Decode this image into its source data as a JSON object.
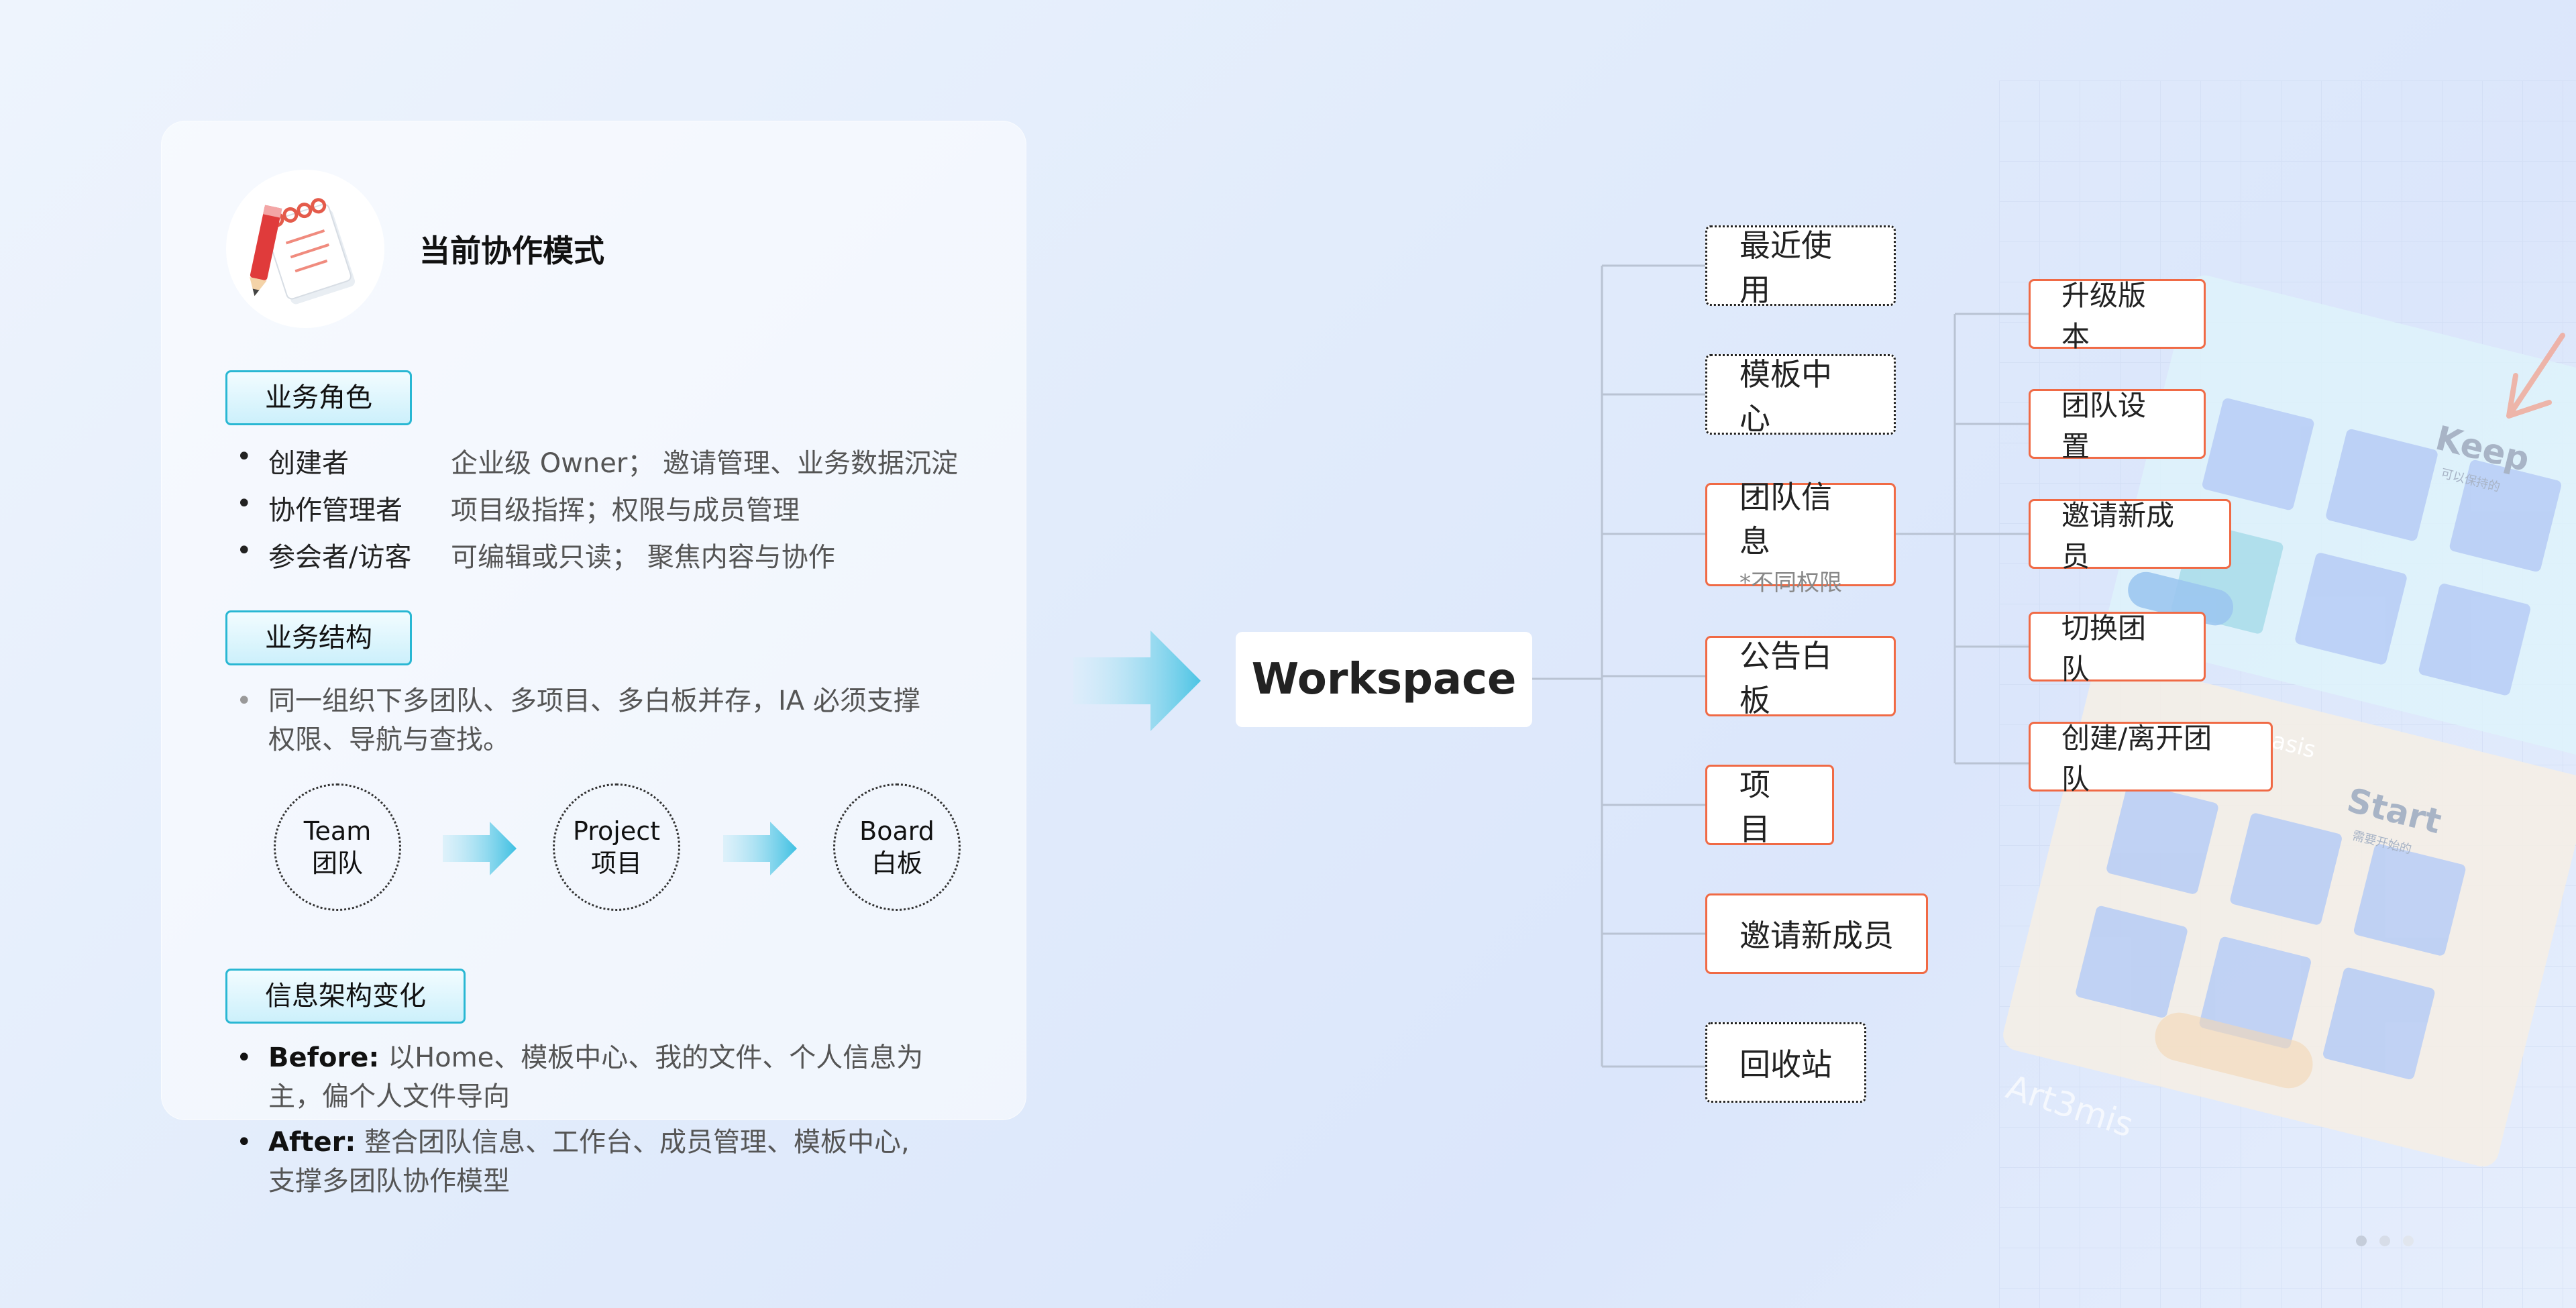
{
  "card": {
    "title": "当前协作模式",
    "roles_tag": "业务角色",
    "roles": [
      {
        "name": "创建者",
        "desc": "企业级 Owner； 邀请管理、业务数据沉淀"
      },
      {
        "name": "协作管理者",
        "desc": "项目级指挥；权限与成员管理"
      },
      {
        "name": "参会者/访客",
        "desc": "可编辑或只读； 聚焦内容与协作"
      }
    ],
    "structure_tag": "业务结构",
    "structure_text_1": "同一组织下多团队、多项目、多白板并存，IA 必须支撑",
    "structure_text_2": "权限、导航与查找。",
    "flow": [
      {
        "en": "Team",
        "zh": "团队"
      },
      {
        "en": "Project",
        "zh": "项目"
      },
      {
        "en": "Board",
        "zh": "白板"
      }
    ],
    "ia_tag": "信息架构变化",
    "before_label": "Before:",
    "before_text_1": "以Home、模板中心、我的文件、个人信息为",
    "before_text_2": "主，偏个人文件导向",
    "after_label": "After:",
    "after_text_1": "整合团队信息、工作台、成员管理、模板中心,",
    "after_text_2": "支撑多团队协作模型"
  },
  "diagram": {
    "root": "Workspace",
    "level1": [
      {
        "label": "最近使用",
        "style": "dotted"
      },
      {
        "label": "模板中心",
        "style": "dotted"
      },
      {
        "label": "团队信息",
        "sub": "*不同权限",
        "style": "orange"
      },
      {
        "label": "公告白板",
        "style": "orange"
      },
      {
        "label": "项目",
        "style": "orange"
      },
      {
        "label": "邀请新成员",
        "style": "orange"
      },
      {
        "label": "回收站",
        "style": "dotted"
      }
    ],
    "level2": [
      {
        "label": "升级版本"
      },
      {
        "label": "团队设置"
      },
      {
        "label": "邀请新成员"
      },
      {
        "label": "切换团队"
      },
      {
        "label": "创建/离开团队"
      }
    ]
  },
  "decor": {
    "keep_title": "Keep",
    "keep_sub": "可以保持的",
    "start_title": "Start",
    "start_sub": "需要开始的",
    "tag_oasis": "Oasis",
    "tag_art": "Art3mis"
  },
  "colors": {
    "accent_cyan": "#29b7d3",
    "accent_orange": "#f06a45",
    "line_gray": "#b9c3d3"
  }
}
